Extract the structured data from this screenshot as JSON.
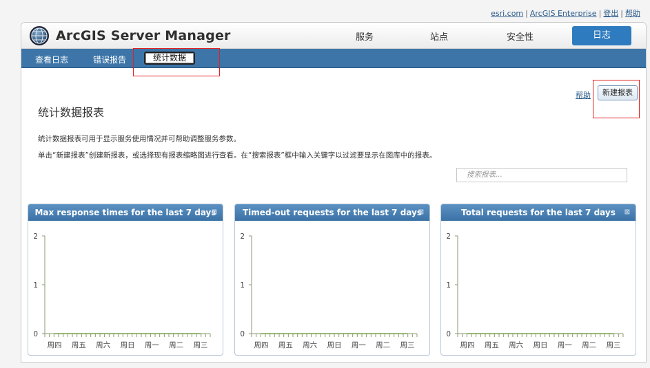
{
  "top_links": {
    "esri": "esri.com",
    "enterprise": "ArcGIS Enterprise",
    "logout": "登出",
    "help": "帮助"
  },
  "header": {
    "title": "ArcGIS Server Manager",
    "nav": [
      "服务",
      "站点",
      "安全性",
      "日志"
    ],
    "active_nav": "日志"
  },
  "subnav": {
    "items": [
      "查看日志",
      "错误报告",
      "统计数据"
    ],
    "selected": "统计数据"
  },
  "content": {
    "help_label": "帮助",
    "new_report_label": "新建报表",
    "page_title": "统计数据报表",
    "desc1": "统计数据报表可用于显示服务使用情况并可帮助调整服务参数。",
    "desc2": "单击“新建报表”创建新报表，或选择现有报表缩略图进行查看。在“搜索报表”框中输入关键字以过滤要显示在图库中的报表。",
    "search_placeholder": "搜索报表..."
  },
  "colors": {
    "accent": "#3d75a8",
    "active_tab": "#2e7bbf",
    "highlight": "#e02020"
  },
  "chart_data": [
    {
      "type": "line",
      "title": "Max response times for the last 7 days",
      "categories": [
        "周四",
        "周五",
        "周六",
        "周日",
        "周一",
        "周二",
        "周三"
      ],
      "y_ticks": [
        "0",
        "1",
        "2"
      ],
      "ylim": [
        0,
        2
      ],
      "series": [
        {
          "values": [
            0,
            0,
            0,
            0,
            0,
            0,
            0
          ]
        }
      ]
    },
    {
      "type": "line",
      "title": "Timed-out requests for the last 7 days",
      "categories": [
        "周四",
        "周五",
        "周六",
        "周日",
        "周一",
        "周二",
        "周三"
      ],
      "y_ticks": [
        "0",
        "1",
        "2"
      ],
      "ylim": [
        0,
        2
      ],
      "series": [
        {
          "values": [
            0,
            0,
            0,
            0,
            0,
            0,
            0
          ]
        }
      ]
    },
    {
      "type": "line",
      "title": "Total requests for the last 7 days",
      "categories": [
        "周四",
        "周五",
        "周六",
        "周日",
        "周一",
        "周二",
        "周三"
      ],
      "y_ticks": [
        "0",
        "1",
        "2"
      ],
      "ylim": [
        0,
        2
      ],
      "series": [
        {
          "values": [
            0,
            0,
            0,
            0,
            0,
            0,
            0
          ]
        }
      ]
    }
  ]
}
